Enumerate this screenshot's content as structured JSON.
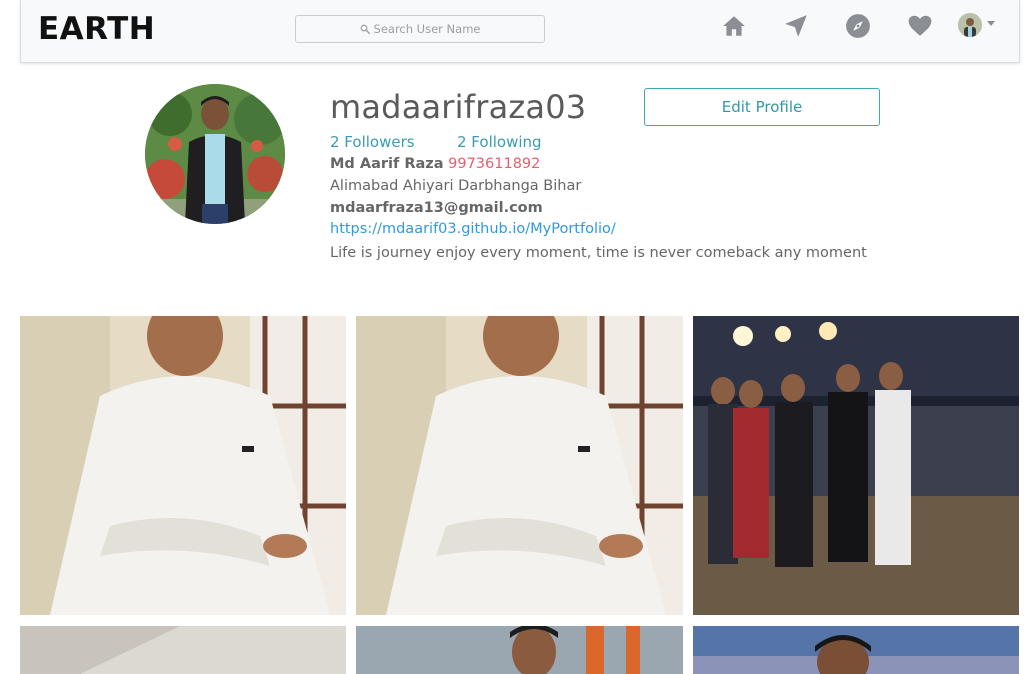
{
  "navbar": {
    "brand": "EARTH",
    "search_placeholder": "Search User Name",
    "icons": [
      "home-icon",
      "send-icon",
      "explore-icon",
      "heart-icon",
      "profile-avatar-icon"
    ]
  },
  "profile": {
    "username": "madaarifraza03",
    "edit_button_label": "Edit Profile",
    "followers_label": "2 Followers",
    "following_label": "2 Following",
    "full_name": "Md Aarif Raza",
    "phone": "9973611892",
    "address": "Alimabad Ahiyari Darbhanga Bihar",
    "email": "mdaarfraza13@gmail.com",
    "website": "https://mdaarif03.github.io/MyPortfolio/",
    "bio": "Life is journey enjoy every moment, time is never comeback any moment"
  },
  "colors": {
    "accent": "#3c9bb0",
    "phone": "#e4606d",
    "link": "#2f9ae0",
    "navbar_bg": "#f8f9fa"
  },
  "posts": [
    "post-photo-1",
    "post-photo-2",
    "post-photo-3",
    "post-photo-4",
    "post-photo-5",
    "post-photo-6"
  ]
}
